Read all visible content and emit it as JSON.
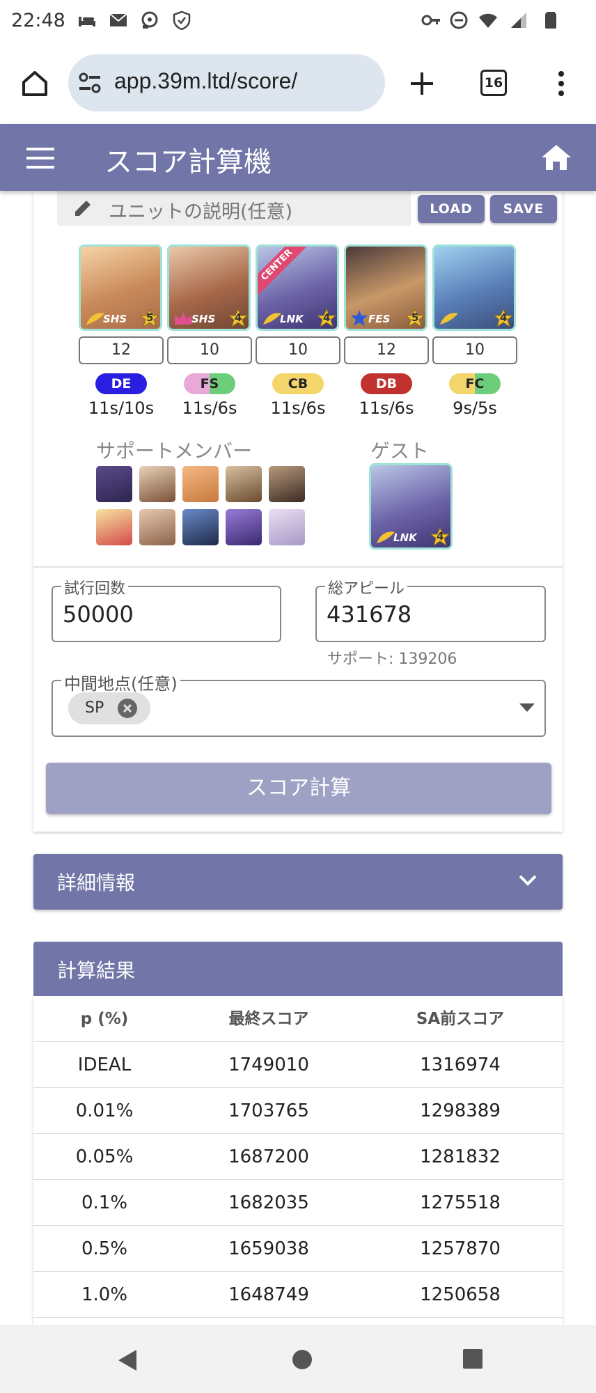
{
  "status_bar": {
    "time": "22:48"
  },
  "browser": {
    "url": "app.39m.ltd/score/",
    "tab_count": "16"
  },
  "app": {
    "title": "スコア計算機"
  },
  "unit": {
    "description_placeholder": "ユニットの説明(任意)",
    "load_label": "LOAD",
    "save_label": "SAVE",
    "center_badge": "CENTER",
    "cards": [
      {
        "rarity": "SHS",
        "stars": "5",
        "level": "12",
        "skill": "DE",
        "skill_color": "#2a1fe0",
        "timing": "11s/10s"
      },
      {
        "rarity": "SHS",
        "stars": "4",
        "level": "10",
        "skill": "FS",
        "skill_color": "#e8a9d9",
        "timing": "11s/6s"
      },
      {
        "rarity": "LNK",
        "stars": "4",
        "level": "10",
        "skill": "CB",
        "skill_color": "#f4d56b",
        "timing": "11s/6s"
      },
      {
        "rarity": "FES",
        "stars": "5",
        "level": "12",
        "skill": "DB",
        "skill_color": "#c0312f",
        "timing": "11s/6s"
      },
      {
        "rarity": "",
        "stars": "4",
        "level": "10",
        "skill": "FC",
        "skill_color": "#f4d56b",
        "timing": "9s/5s"
      }
    ]
  },
  "support": {
    "label": "サポートメンバー"
  },
  "guest": {
    "label": "ゲスト",
    "rarity": "LNK",
    "stars": "4"
  },
  "inputs": {
    "trials_label": "試行回数",
    "trials_value": "50000",
    "appeal_label": "総アピール",
    "appeal_value": "431678",
    "support_note": "サポート: 139206",
    "midpoint_label": "中間地点(任意)",
    "midpoint_chip": "SP"
  },
  "calc_button": "スコア計算",
  "details": {
    "title": "詳細情報"
  },
  "results": {
    "title": "計算結果",
    "headers": [
      "p (%)",
      "最終スコア",
      "SA前スコア"
    ],
    "rows": [
      [
        "IDEAL",
        "1749010",
        "1316974"
      ],
      [
        "0.01%",
        "1703765",
        "1298389"
      ],
      [
        "0.05%",
        "1687200",
        "1281832"
      ],
      [
        "0.1%",
        "1682035",
        "1275518"
      ],
      [
        "0.5%",
        "1659038",
        "1257870"
      ],
      [
        "1.0%",
        "1648749",
        "1250658"
      ]
    ]
  }
}
